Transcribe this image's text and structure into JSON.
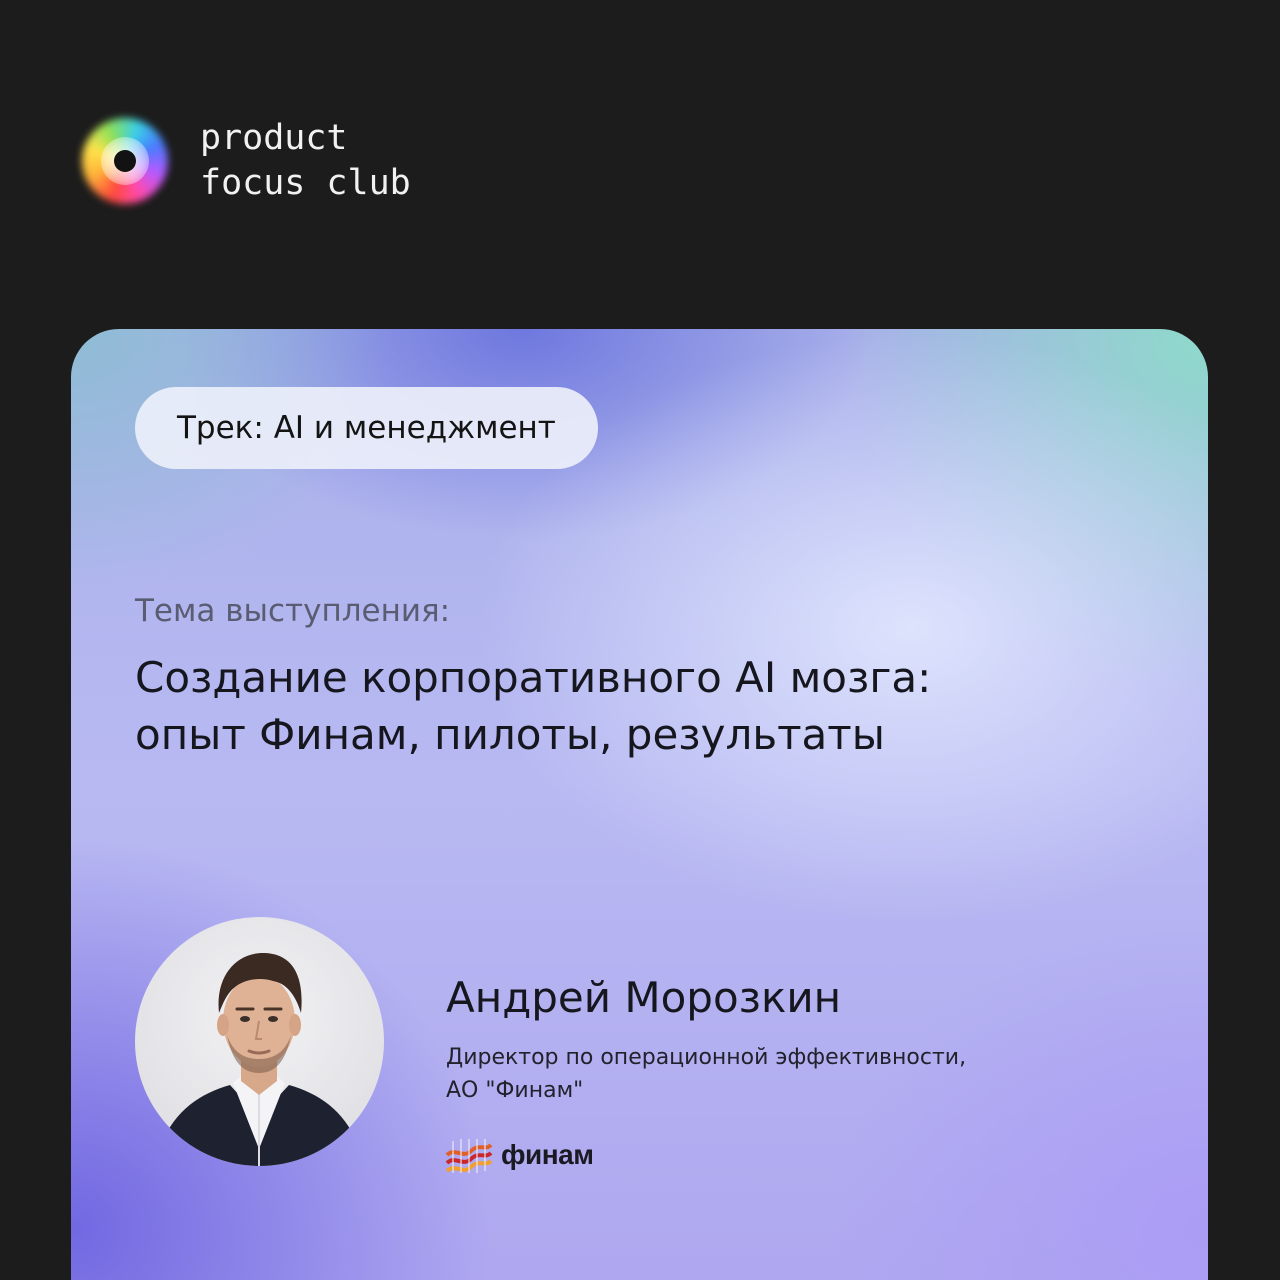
{
  "brand": {
    "line1": "product",
    "line2": "focus club",
    "logo_icon": "focus-lens-icon"
  },
  "card": {
    "track": "Трек: AI и менеджмент",
    "topic_label": "Тема выступления:",
    "topic_title_line1": "Создание корпоративного AI мозга:",
    "topic_title_line2": "опыт Финам, пилоты, результаты"
  },
  "speaker": {
    "name": "Андрей Морозкин",
    "role_line1": "Директор по операционной эффективности,",
    "role_line2": "АО \"Финам\"",
    "company_logo_text": "финам"
  },
  "colors": {
    "page_background": "#1c1c1c",
    "card_violet": "#aea6f0",
    "card_teal": "#8cdcc8",
    "pill_background": "#eceffa"
  }
}
